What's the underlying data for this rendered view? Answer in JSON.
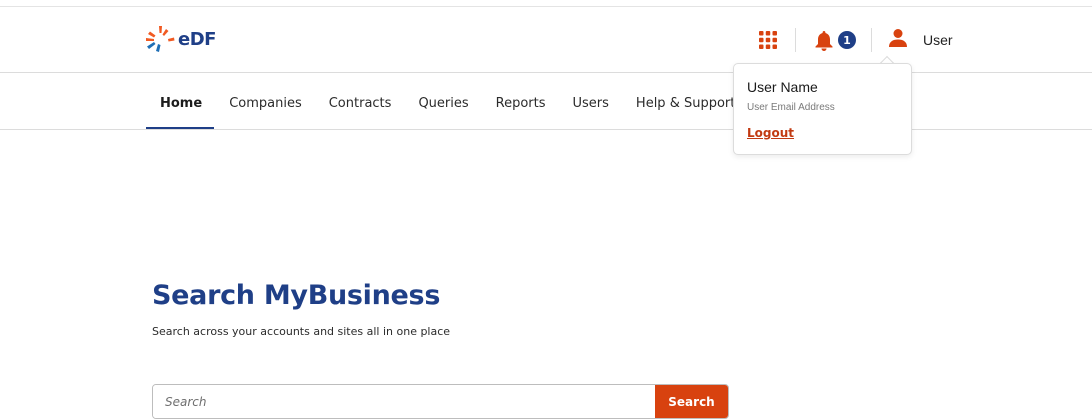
{
  "brand": {
    "name": "eDF",
    "logo_icon": "edf-sun-icon",
    "colors": {
      "primary": "#1f3f87",
      "accent": "#d8420f",
      "logo_orange": "#f15a22",
      "logo_green": "#1f3f87"
    }
  },
  "header": {
    "apps_icon": "grid-apps-icon",
    "notifications": {
      "icon": "bell-icon",
      "count": "1"
    },
    "user": {
      "icon": "person-icon",
      "label": "User"
    }
  },
  "nav": {
    "items": [
      {
        "label": "Home",
        "active": true
      },
      {
        "label": "Companies",
        "active": false
      },
      {
        "label": "Contracts",
        "active": false
      },
      {
        "label": "Queries",
        "active": false
      },
      {
        "label": "Reports",
        "active": false
      },
      {
        "label": "Users",
        "active": false
      },
      {
        "label": "Help & Support",
        "active": false
      }
    ]
  },
  "user_menu": {
    "name": "User Name",
    "email": "User Email Address",
    "logout_label": "Logout"
  },
  "hero": {
    "title": "Search MyBusiness",
    "subtitle": "Search across your accounts and sites all in one place"
  },
  "search": {
    "placeholder": "Search",
    "value": "",
    "button_label": "Search"
  }
}
